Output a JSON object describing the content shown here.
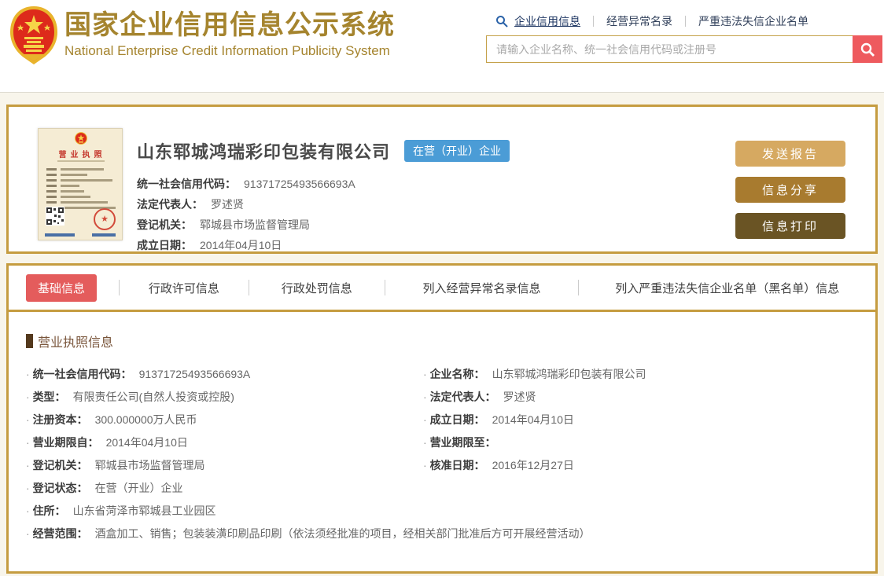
{
  "header": {
    "title": "国家企业信用信息公示系统",
    "subtitle": "National Enterprise Credit Information Publicity System",
    "nav": [
      {
        "label": "企业信用信息"
      },
      {
        "label": "经营异常名录"
      },
      {
        "label": "严重违法失信企业名单"
      }
    ],
    "search_placeholder": "请输入企业名称、统一社会信用代码或注册号"
  },
  "company": {
    "name": "山东郓城鸿瑞彩印包装有限公司",
    "status": "在营（开业）企业",
    "license_thumb_title": "营业执照",
    "fields": [
      {
        "label": "统一社会信用代码：",
        "value": "91371725493566693A"
      },
      {
        "label": "法定代表人：",
        "value": "罗述贤"
      },
      {
        "label": "登记机关：",
        "value": "郓城县市场监督管理局"
      },
      {
        "label": "成立日期：",
        "value": "2014年04月10日"
      }
    ],
    "buttons": [
      {
        "label": "发送报告"
      },
      {
        "label": "信息分享"
      },
      {
        "label": "信息打印"
      }
    ]
  },
  "tabs": [
    {
      "label": "基础信息",
      "active": true
    },
    {
      "label": "行政许可信息",
      "active": false
    },
    {
      "label": "行政处罚信息",
      "active": false
    },
    {
      "label": "列入经营异常名录信息",
      "active": false
    },
    {
      "label": "列入严重违法失信企业名单（黑名单）信息",
      "active": false
    }
  ],
  "license_section": {
    "heading": "营业执照信息",
    "rows": [
      {
        "l_label": "统一社会信用代码：",
        "l_value": "91371725493566693A",
        "r_label": "企业名称：",
        "r_value": "山东郓城鸿瑞彩印包装有限公司"
      },
      {
        "l_label": "类型：",
        "l_value": "有限责任公司(自然人投资或控股)",
        "r_label": "法定代表人：",
        "r_value": "罗述贤"
      },
      {
        "l_label": "注册资本：",
        "l_value": "300.000000万人民币",
        "r_label": "成立日期：",
        "r_value": "2014年04月10日"
      },
      {
        "l_label": "营业期限自：",
        "l_value": "2014年04月10日",
        "r_label": "营业期限至：",
        "r_value": ""
      },
      {
        "l_label": "登记机关：",
        "l_value": "郓城县市场监督管理局",
        "r_label": "核准日期：",
        "r_value": "2016年12月27日"
      },
      {
        "l_label": "登记状态：",
        "l_value": "在营（开业）企业",
        "r_label": "",
        "r_value": ""
      },
      {
        "l_label": "住所：",
        "l_value": "山东省菏泽市郓城县工业园区",
        "r_label": "",
        "r_value": ""
      },
      {
        "l_label": "经营范围：",
        "l_value": "酒盒加工、销售；包装装潢印刷品印刷（依法须经批准的项目，经相关部门批准后方可开展经营活动）",
        "r_label": "",
        "r_value": ""
      }
    ]
  },
  "colors": {
    "title_gold": "#a5842e",
    "card_border_gold": "#c59c40",
    "accent_red": "#e45c5c",
    "search_button_red": "#ee5a5e",
    "status_badge_blue": "#4b9cd6",
    "button_tan": "#d6a961",
    "button_brown": "#a87b2f",
    "button_dark_brown": "#6a5424",
    "section_title_brown": "#7a563c"
  }
}
